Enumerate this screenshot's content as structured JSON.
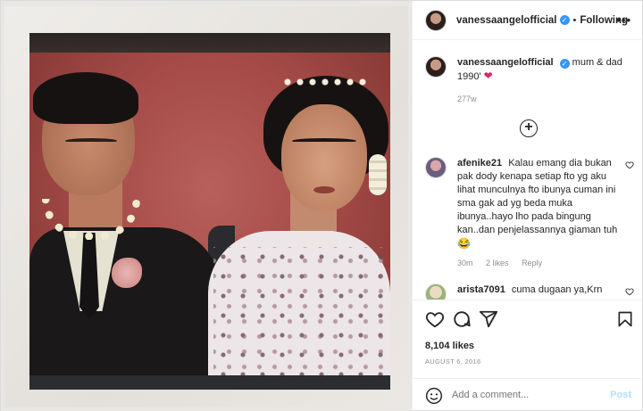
{
  "header": {
    "username": "vanessaangelofficial",
    "separator": "•",
    "follow_label": "Following",
    "more_label": "•••"
  },
  "caption": {
    "username": "vanessaangelofficial",
    "text": "mum & dad 1990'",
    "emoji": "❤",
    "time": "277w"
  },
  "load_more_label": "+",
  "comments": [
    {
      "username": "afenike21",
      "text": "Kalau emang dia bukan pak dody kenapa setiap fto yg aku lihat munculnya fto ibunya cuman ini sma gak ad yg beda muka ibunya..hayo lho pada bingung kan..dan penjelassannya giaman tuh",
      "emoji": "😂",
      "time": "30m",
      "likes": "2 likes",
      "reply": "Reply"
    },
    {
      "username": "arista7091",
      "text": "cuma dugaan ya,Krn"
    }
  ],
  "actions": {
    "likes": "8,104 likes",
    "date": "AUGUST 6, 2016",
    "comment_placeholder": "Add a comment...",
    "post_label": "Post"
  },
  "icons": {
    "verified": "verified-badge-icon",
    "like": "heart-icon",
    "comment": "comment-icon",
    "share": "share-icon",
    "save": "bookmark-icon",
    "emoji": "smiley-icon",
    "load_more": "plus-circle-icon"
  },
  "colors": {
    "verified": "#3897f0",
    "link_disabled": "#b2dffc",
    "meta": "#8e8e8e",
    "heart": "#e0245e"
  }
}
